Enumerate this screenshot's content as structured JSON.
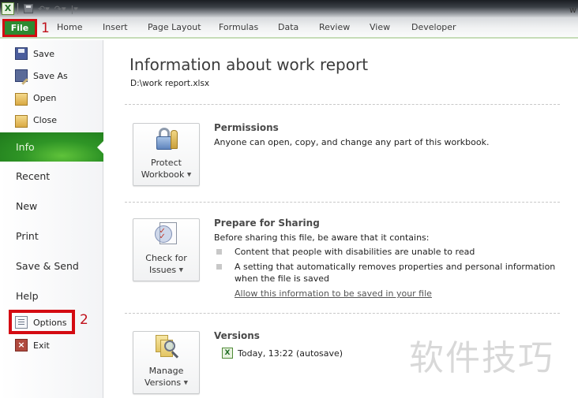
{
  "window": {
    "title_partial": "w"
  },
  "quick_access": {
    "app_icon": "excel-icon",
    "items": [
      "save-icon",
      "undo-icon",
      "redo-icon",
      "customize-qat-icon"
    ]
  },
  "ribbon": {
    "file_tab": "File",
    "tabs": [
      "Home",
      "Insert",
      "Page Layout",
      "Formulas",
      "Data",
      "Review",
      "View",
      "Developer"
    ]
  },
  "annotations": {
    "step1": "1",
    "step2": "2",
    "highlight_color": "#d40b12"
  },
  "sidebar": {
    "commands": [
      {
        "label": "Save",
        "icon": "save-icon"
      },
      {
        "label": "Save As",
        "icon": "save-as-icon"
      },
      {
        "label": "Open",
        "icon": "open-folder-icon"
      },
      {
        "label": "Close",
        "icon": "close-folder-icon"
      }
    ],
    "active": "Info",
    "nav": [
      "Recent",
      "New",
      "Print",
      "Save & Send",
      "Help"
    ],
    "bottom_commands": [
      {
        "label": "Options",
        "icon": "options-icon"
      },
      {
        "label": "Exit",
        "icon": "exit-icon"
      }
    ],
    "accent_color": "#2f9526"
  },
  "main": {
    "title": "Information about work report",
    "path": "D:\\work report.xlsx",
    "permissions": {
      "button": {
        "line1": "Protect",
        "line2": "Workbook"
      },
      "title": "Permissions",
      "text": "Anyone can open, copy, and change any part of this workbook."
    },
    "sharing": {
      "button": {
        "line1": "Check for",
        "line2": "Issues"
      },
      "title": "Prepare for Sharing",
      "intro": "Before sharing this file, be aware that it contains:",
      "bullets": [
        "Content that people with disabilities are unable to read",
        "A setting that automatically removes properties and personal information",
        "when the file is saved"
      ],
      "link": "Allow this information to be saved in your file"
    },
    "versions": {
      "button": {
        "line1": "Manage",
        "line2": "Versions"
      },
      "title": "Versions",
      "items": [
        "Today, 13:22 (autosave)"
      ]
    }
  },
  "watermark": "软件技巧"
}
